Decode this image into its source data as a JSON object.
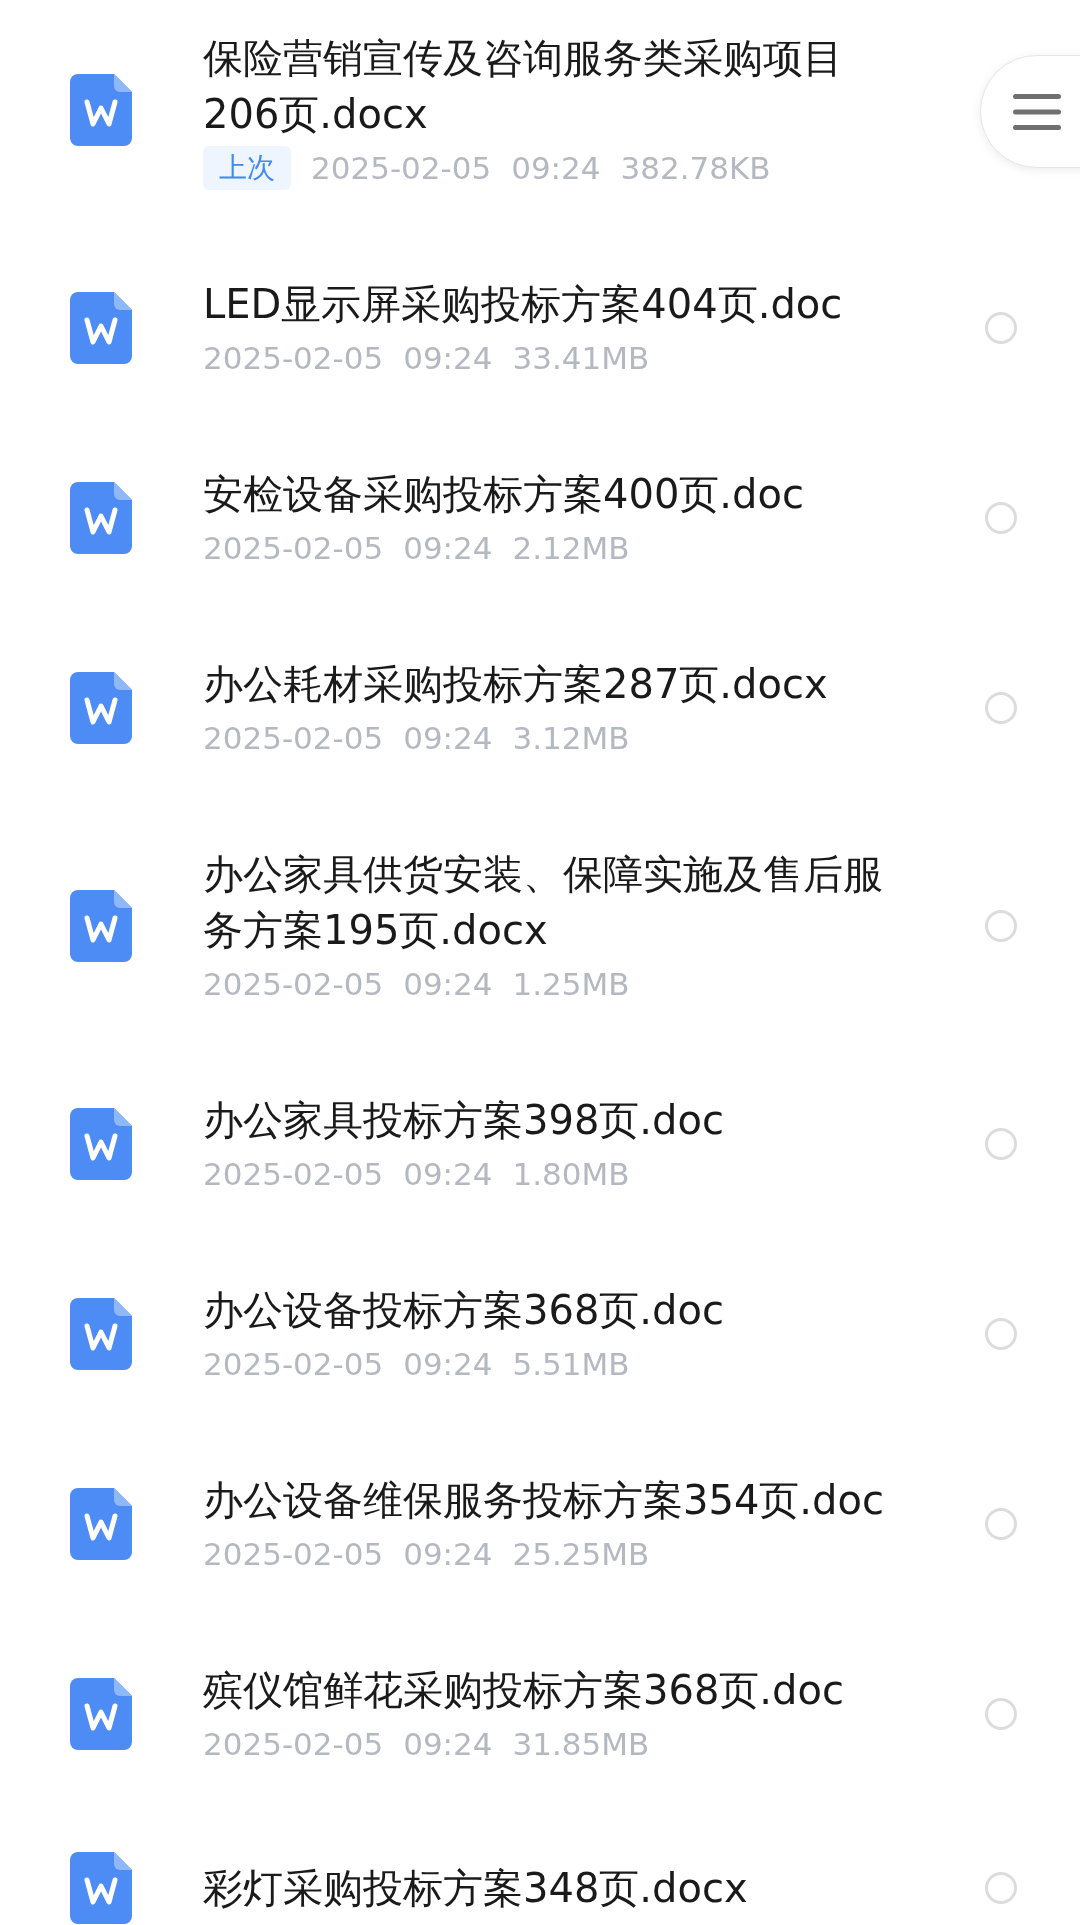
{
  "files": [
    {
      "title": "保险营销宣传及咨询服务类采购项目206页.docx",
      "badge": "上次",
      "date": "2025-02-05",
      "time": "09:24",
      "size": "382.78KB"
    },
    {
      "title": "LED显示屏采购投标方案404页.doc",
      "date": "2025-02-05",
      "time": "09:24",
      "size": "33.41MB",
      "selected": false
    },
    {
      "title": "安检设备采购投标方案400页.doc",
      "date": "2025-02-05",
      "time": "09:24",
      "size": "2.12MB",
      "selected": false
    },
    {
      "title": "办公耗材采购投标方案287页.docx",
      "date": "2025-02-05",
      "time": "09:24",
      "size": "3.12MB",
      "selected": false
    },
    {
      "title": "办公家具供货安装、保障实施及售后服务方案195页.docx",
      "date": "2025-02-05",
      "time": "09:24",
      "size": "1.25MB",
      "selected": false
    },
    {
      "title": "办公家具投标方案398页.doc",
      "date": "2025-02-05",
      "time": "09:24",
      "size": "1.80MB",
      "selected": false
    },
    {
      "title": "办公设备投标方案368页.doc",
      "date": "2025-02-05",
      "time": "09:24",
      "size": "5.51MB",
      "selected": false
    },
    {
      "title": "办公设备维保服务投标方案354页.doc",
      "date": "2025-02-05",
      "time": "09:24",
      "size": "25.25MB",
      "selected": false
    },
    {
      "title": "殡仪馆鲜花采购投标方案368页.doc",
      "date": "2025-02-05",
      "time": "09:24",
      "size": "31.85MB",
      "selected": false
    },
    {
      "title": "彩灯采购投标方案348页.docx",
      "selected": false
    }
  ]
}
